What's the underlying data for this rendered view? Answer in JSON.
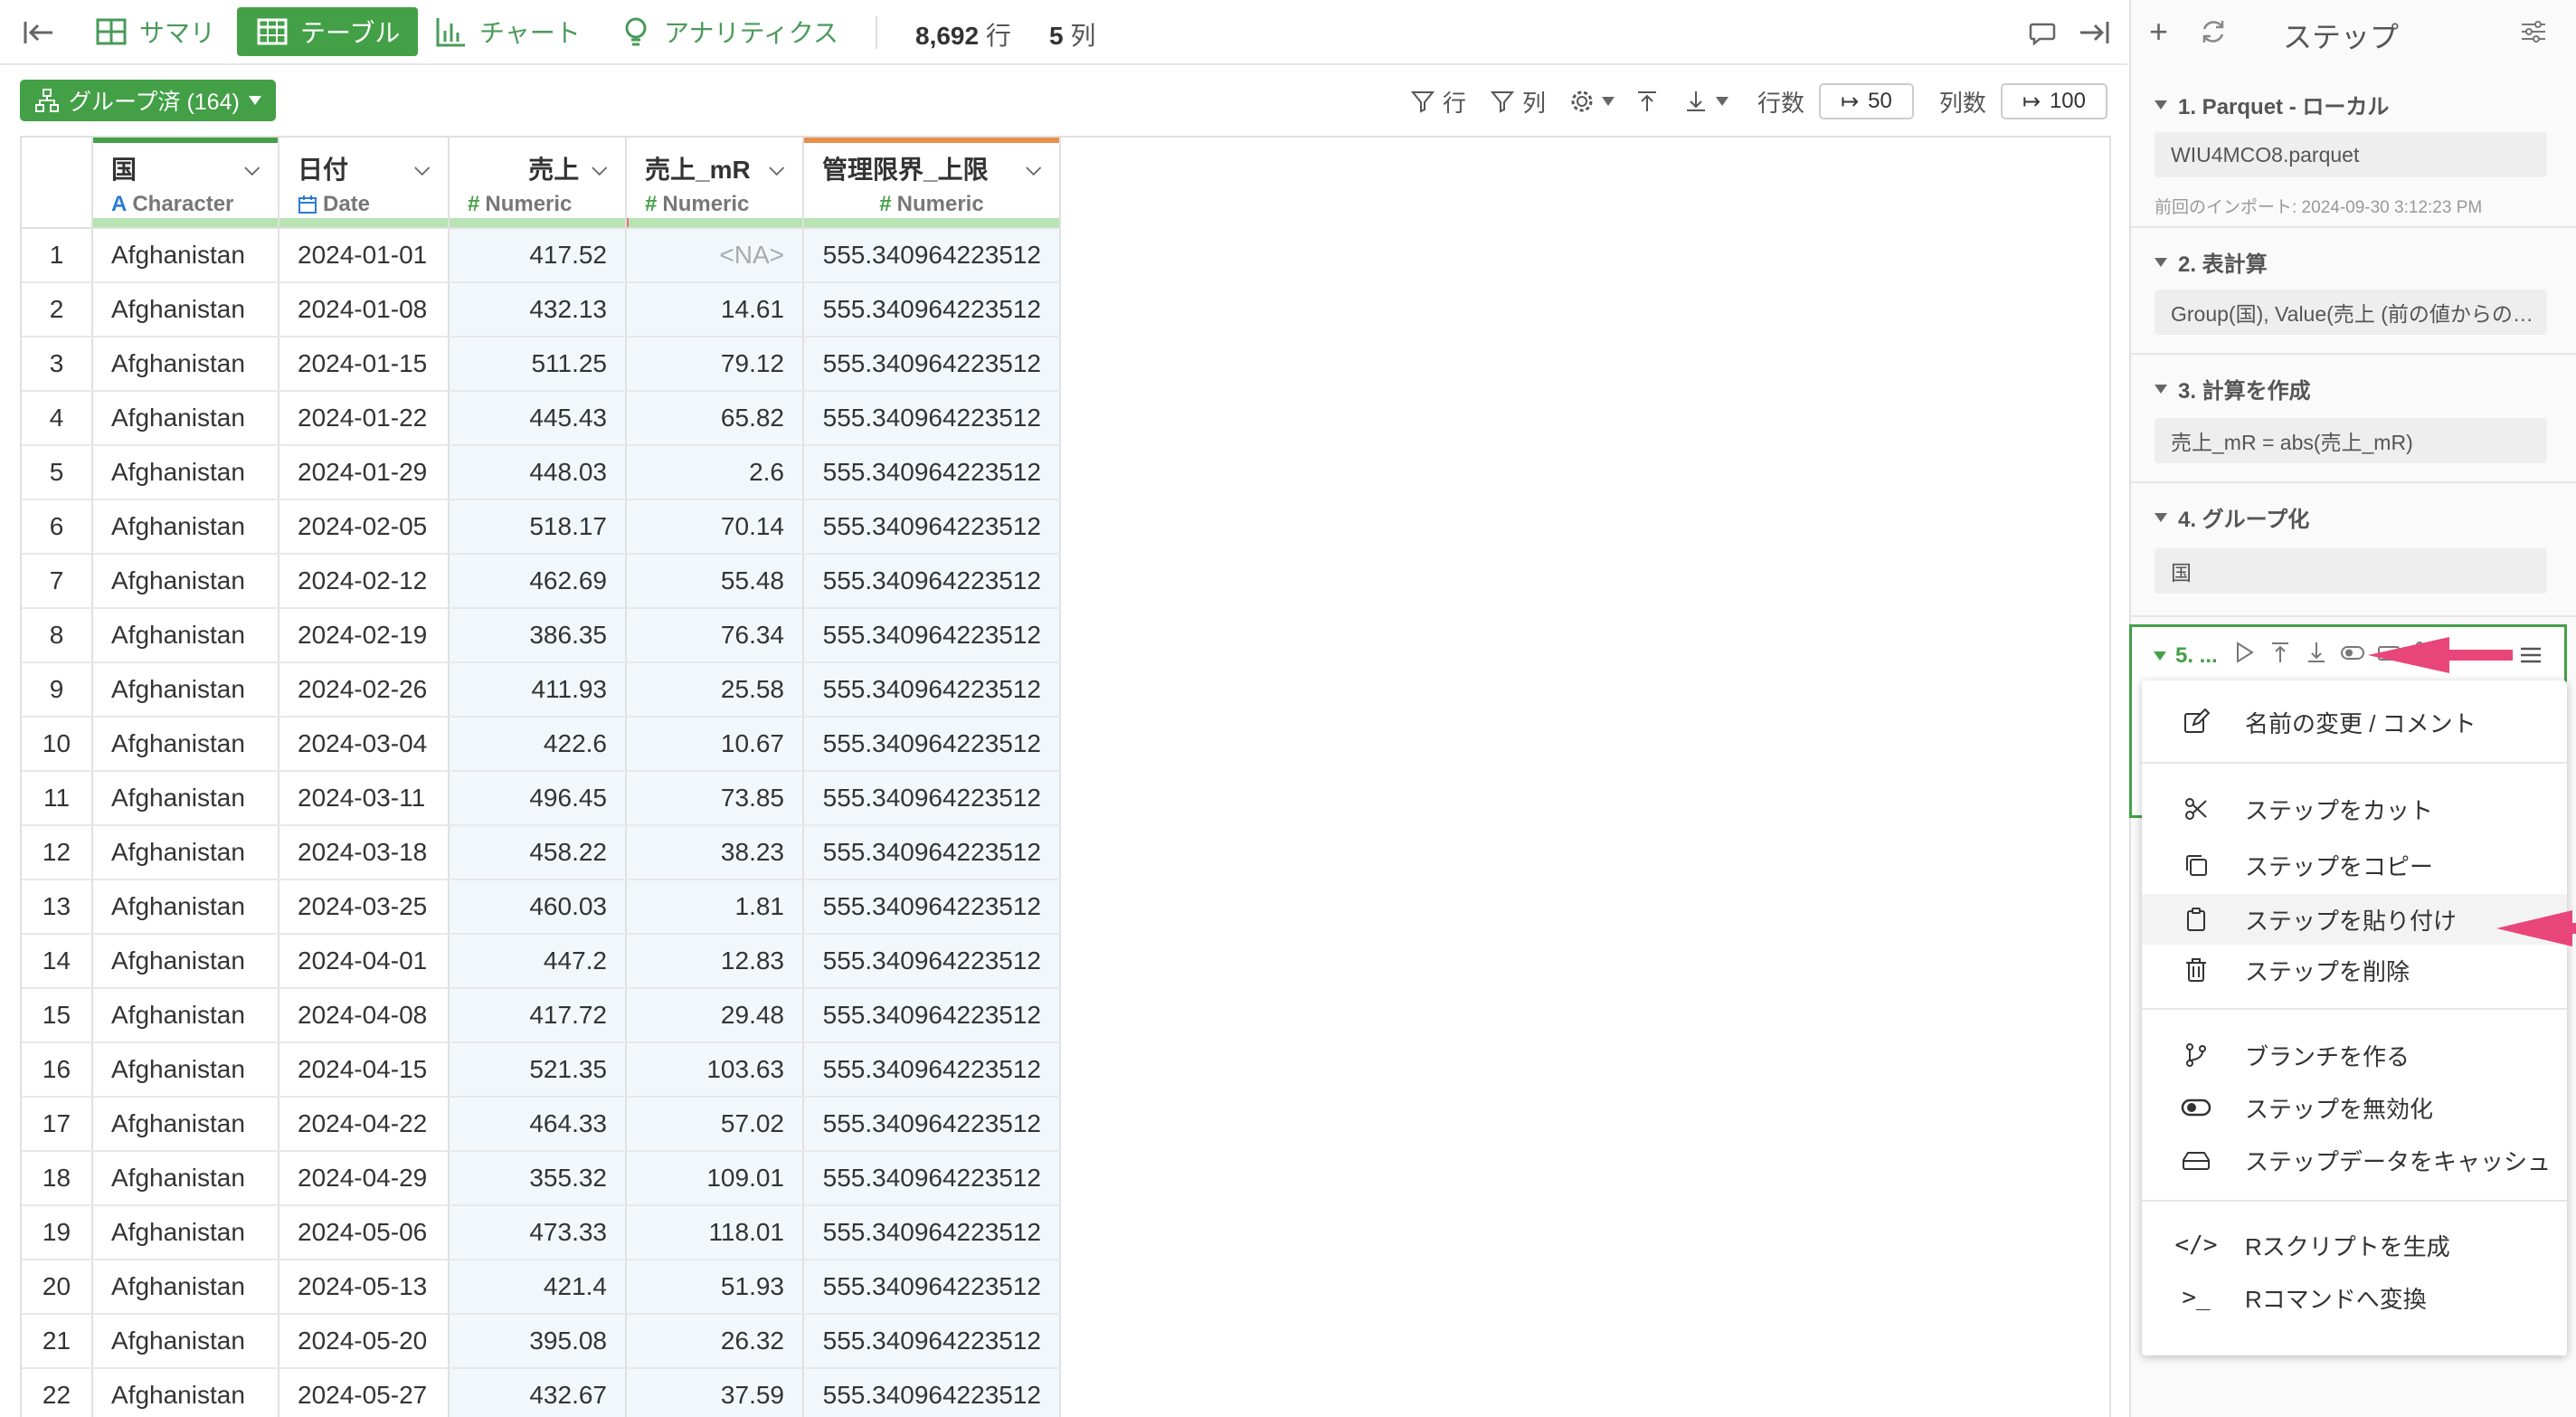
{
  "topbar": {
    "tabs": [
      {
        "label": "サマリ"
      },
      {
        "label": "テーブル"
      },
      {
        "label": "チャート"
      },
      {
        "label": "アナリティクス"
      }
    ],
    "rows_count": "8,692",
    "rows_unit": "行",
    "cols_count": "5",
    "cols_unit": "列"
  },
  "subtoolbar": {
    "group_label": "グループ済 (164)",
    "row_filter": "行",
    "col_filter": "列",
    "rows_label": "行数",
    "rows_value": "50",
    "cols_label": "列数",
    "cols_value": "100"
  },
  "table": {
    "columns": [
      {
        "name": "国",
        "type": "Character",
        "type_icon": "A"
      },
      {
        "name": "日付",
        "type": "Date",
        "type_icon": "calendar-icon"
      },
      {
        "name": "売上",
        "type": "Numeric",
        "type_icon": "#"
      },
      {
        "name": "売上_mR",
        "type": "Numeric",
        "type_icon": "#"
      },
      {
        "name": "管理限界_上限",
        "type": "Numeric",
        "type_icon": "#"
      }
    ],
    "rows": [
      [
        "1",
        "Afghanistan",
        "2024-01-01",
        "417.52",
        "<NA>",
        "555.340964223512"
      ],
      [
        "2",
        "Afghanistan",
        "2024-01-08",
        "432.13",
        "14.61",
        "555.340964223512"
      ],
      [
        "3",
        "Afghanistan",
        "2024-01-15",
        "511.25",
        "79.12",
        "555.340964223512"
      ],
      [
        "4",
        "Afghanistan",
        "2024-01-22",
        "445.43",
        "65.82",
        "555.340964223512"
      ],
      [
        "5",
        "Afghanistan",
        "2024-01-29",
        "448.03",
        "2.6",
        "555.340964223512"
      ],
      [
        "6",
        "Afghanistan",
        "2024-02-05",
        "518.17",
        "70.14",
        "555.340964223512"
      ],
      [
        "7",
        "Afghanistan",
        "2024-02-12",
        "462.69",
        "55.48",
        "555.340964223512"
      ],
      [
        "8",
        "Afghanistan",
        "2024-02-19",
        "386.35",
        "76.34",
        "555.340964223512"
      ],
      [
        "9",
        "Afghanistan",
        "2024-02-26",
        "411.93",
        "25.58",
        "555.340964223512"
      ],
      [
        "10",
        "Afghanistan",
        "2024-03-04",
        "422.6",
        "10.67",
        "555.340964223512"
      ],
      [
        "11",
        "Afghanistan",
        "2024-03-11",
        "496.45",
        "73.85",
        "555.340964223512"
      ],
      [
        "12",
        "Afghanistan",
        "2024-03-18",
        "458.22",
        "38.23",
        "555.340964223512"
      ],
      [
        "13",
        "Afghanistan",
        "2024-03-25",
        "460.03",
        "1.81",
        "555.340964223512"
      ],
      [
        "14",
        "Afghanistan",
        "2024-04-01",
        "447.2",
        "12.83",
        "555.340964223512"
      ],
      [
        "15",
        "Afghanistan",
        "2024-04-08",
        "417.72",
        "29.48",
        "555.340964223512"
      ],
      [
        "16",
        "Afghanistan",
        "2024-04-15",
        "521.35",
        "103.63",
        "555.340964223512"
      ],
      [
        "17",
        "Afghanistan",
        "2024-04-22",
        "464.33",
        "57.02",
        "555.340964223512"
      ],
      [
        "18",
        "Afghanistan",
        "2024-04-29",
        "355.32",
        "109.01",
        "555.340964223512"
      ],
      [
        "19",
        "Afghanistan",
        "2024-05-06",
        "473.33",
        "118.01",
        "555.340964223512"
      ],
      [
        "20",
        "Afghanistan",
        "2024-05-13",
        "421.4",
        "51.93",
        "555.340964223512"
      ],
      [
        "21",
        "Afghanistan",
        "2024-05-20",
        "395.08",
        "26.32",
        "555.340964223512"
      ],
      [
        "22",
        "Afghanistan",
        "2024-05-27",
        "432.67",
        "37.59",
        "555.340964223512"
      ]
    ]
  },
  "steps": {
    "header": "ステップ",
    "items": [
      {
        "title": "1. Parquet - ローカル",
        "box": "WIU4MCO8.parquet",
        "note": "前回のインポート: 2024-09-30 3:12:23 PM"
      },
      {
        "title": "2. 表計算",
        "box": "Group(国), Value(売上 (前の値からの…"
      },
      {
        "title": "3. 計算を作成",
        "box": "売上_mR = abs(売上_mR)"
      },
      {
        "title": "4. グループ化",
        "box": "国"
      },
      {
        "title": "5. ..."
      }
    ]
  },
  "context_menu": {
    "items": [
      {
        "label": "名前の変更 / コメント",
        "icon": "edit-icon"
      },
      {
        "label": "ステップをカット",
        "icon": "scissors-icon"
      },
      {
        "label": "ステップをコピー",
        "icon": "copy-icon"
      },
      {
        "label": "ステップを貼り付け",
        "icon": "clipboard-icon"
      },
      {
        "label": "ステップを削除",
        "icon": "trash-icon"
      },
      {
        "label": "ブランチを作る",
        "icon": "branch-icon"
      },
      {
        "label": "ステップを無効化",
        "icon": "toggle-icon"
      },
      {
        "label": "ステップデータをキャッシュ",
        "icon": "cache-icon"
      },
      {
        "label": "Rスクリプトを生成",
        "icon": "code-icon"
      },
      {
        "label": "Rコマンドへ変換",
        "icon": "terminal-icon"
      }
    ]
  },
  "colors": {
    "accent_green": "#43a047",
    "annotation_arrow": "#e8457a",
    "numeric_col_bg": "#f2f7fc"
  }
}
